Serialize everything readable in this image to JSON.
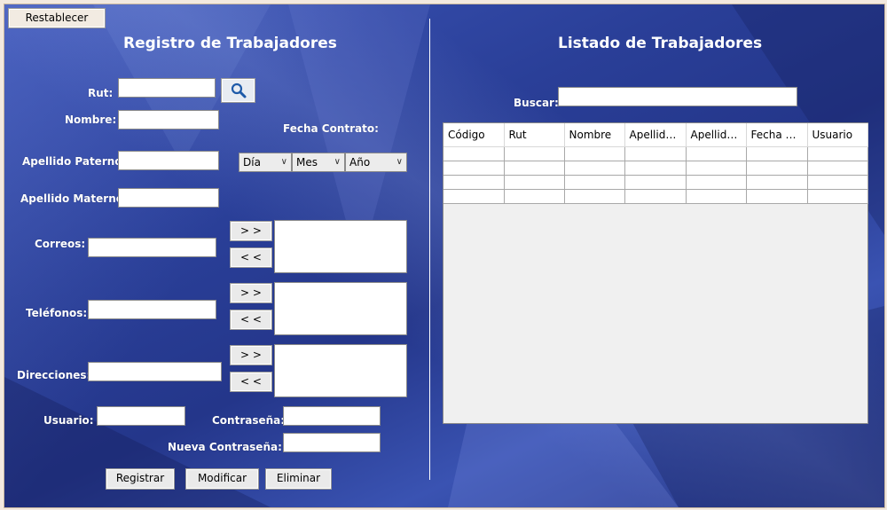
{
  "toolbar": {
    "reset_label": "Restablecer"
  },
  "left": {
    "title": "Registro de Trabajadores",
    "labels": {
      "rut": "Rut:",
      "nombre": "Nombre:",
      "fecha_contrato": "Fecha Contrato:",
      "apellido_paterno": "Apellido Paterno:",
      "apellido_materno": "Apellido Materno:",
      "correos": "Correos:",
      "telefonos": "Teléfonos:",
      "direcciones": "Direcciones:",
      "usuario": "Usuario:",
      "contrasena": "Contraseña:",
      "nueva_contrasena": "Nueva Contraseña:"
    },
    "date_selects": {
      "dia": "Día",
      "mes": "Mes",
      "anio": "Año"
    },
    "move_buttons": {
      "add": "> >",
      "remove": "< <"
    },
    "action_buttons": {
      "registrar": "Registrar",
      "modificar": "Modificar",
      "eliminar": "Eliminar"
    }
  },
  "right": {
    "title": "Listado de Trabajadores",
    "search_label": "Buscar:",
    "table": {
      "columns": [
        "Código",
        "Rut",
        "Nombre",
        "Apellido ...",
        "Apellido ...",
        "Fecha Co...",
        "Usuario"
      ]
    }
  },
  "colors": {
    "background": "#2a3f98",
    "text": "#ffffff"
  },
  "icons": {
    "search": "search-icon"
  }
}
